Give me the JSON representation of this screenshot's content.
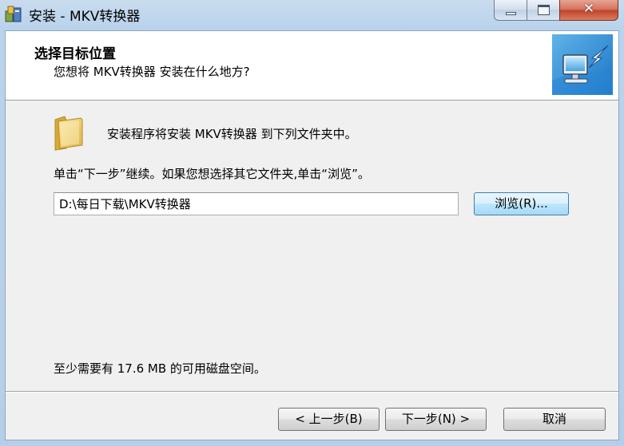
{
  "window": {
    "title": "安装 - MKV转换器",
    "close_glyph": "✕"
  },
  "header": {
    "title": "选择目标位置",
    "subtitle": "您想将 MKV转换器 安装在什么地方?"
  },
  "body": {
    "install_description": "安装程序将安装 MKV转换器 到下列文件夹中。",
    "instruction": "单击“下一步”继续。如果您想选择其它文件夹,单击“浏览”。",
    "path_value": "D:\\每日下载\\MKV转换器",
    "browse_label": "浏览(R)...",
    "space_required": "至少需要有 17.6 MB 的可用磁盘空间。"
  },
  "buttons": {
    "back_label": "< 上一步(B)",
    "next_label": "下一步(N) >",
    "cancel_label": "取消"
  },
  "icons": {
    "app": "installer-app-icon",
    "header": "computer-install-icon",
    "folder": "folder-icon"
  },
  "colors": {
    "titlebar": "#bad3ec",
    "close_button": "#c0412a",
    "dialog_bg": "#f0f0f0",
    "focused_button_border": "#3c7fb1"
  }
}
